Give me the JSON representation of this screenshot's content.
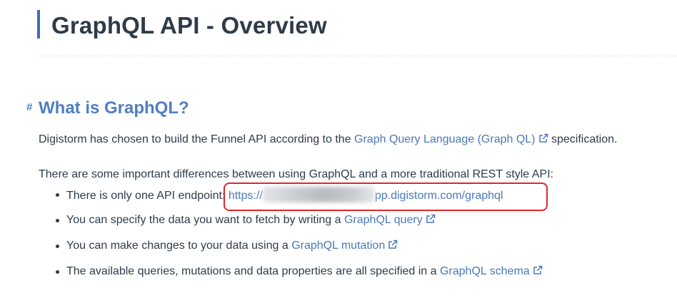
{
  "page": {
    "title": "GraphQL API - Overview"
  },
  "section": {
    "anchor": "#",
    "heading": "What is GraphQL?"
  },
  "intro": {
    "prefix": "Digistorm has chosen to build the Funnel API according to the ",
    "link_text": "Graph Query Language (Graph QL)",
    "suffix": " specification."
  },
  "differences": {
    "lead": "There are some important differences between using GraphQL and a more traditional REST style API:",
    "items": [
      {
        "text": "There is only one API endpoint: ",
        "link_prefix": "https://",
        "link_suffix": "pp.digistorm.com/graphql"
      },
      {
        "text": "You can specify the data you want to fetch by writing a ",
        "link_text": "GraphQL query"
      },
      {
        "text": "You can make changes to your data using a ",
        "link_text": "GraphQL mutation"
      },
      {
        "text": "The available queries, mutations and data properties are all specified in a ",
        "link_text": "GraphQL schema"
      }
    ]
  },
  "colors": {
    "accent": "#4f7fc0",
    "link": "#4a79b8",
    "highlight": "#e0262b",
    "text": "#2f3b49"
  },
  "icons": {
    "external_link": "external-link-icon"
  }
}
